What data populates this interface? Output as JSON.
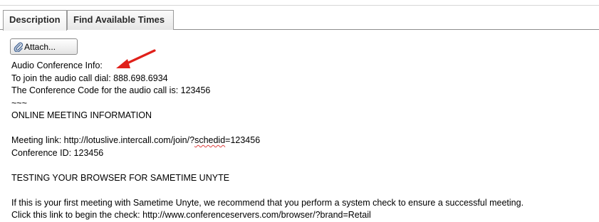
{
  "tabs": [
    {
      "label": "Description",
      "active": true
    },
    {
      "label": "Find Available Times",
      "active": false
    }
  ],
  "attach_button": {
    "label": "Attach...",
    "icon": "paperclip-icon"
  },
  "annotation": {
    "icon": "red-arrow-icon",
    "color": "#e0201a"
  },
  "body": {
    "line1": "Audio Conference Info:",
    "line2": "To join the audio call dial: 888.698.6934",
    "line3": "The Conference Code for the audio call is: 123456",
    "line4": "~~~",
    "line5": "ONLINE MEETING INFORMATION",
    "meeting_link_prefix": "Meeting link: http://lotuslive.intercall.com/join/?",
    "meeting_link_misspelled": "schedid",
    "meeting_link_suffix": "=123456",
    "conference_id": "Conference ID: 123456",
    "testing_heading": "TESTING YOUR BROWSER FOR SAMETIME UNYTE",
    "first_meeting": "If this is your first meeting with Sametime Unyte, we recommend that you perform a system check to ensure a successful meeting.",
    "check_link": "Click this link to begin the check: http://www.conferenceservers.com/browser/?brand=Retail"
  },
  "colors": {
    "spellcheck_underline": "#e04040",
    "tab_border": "#9a9a9a"
  }
}
